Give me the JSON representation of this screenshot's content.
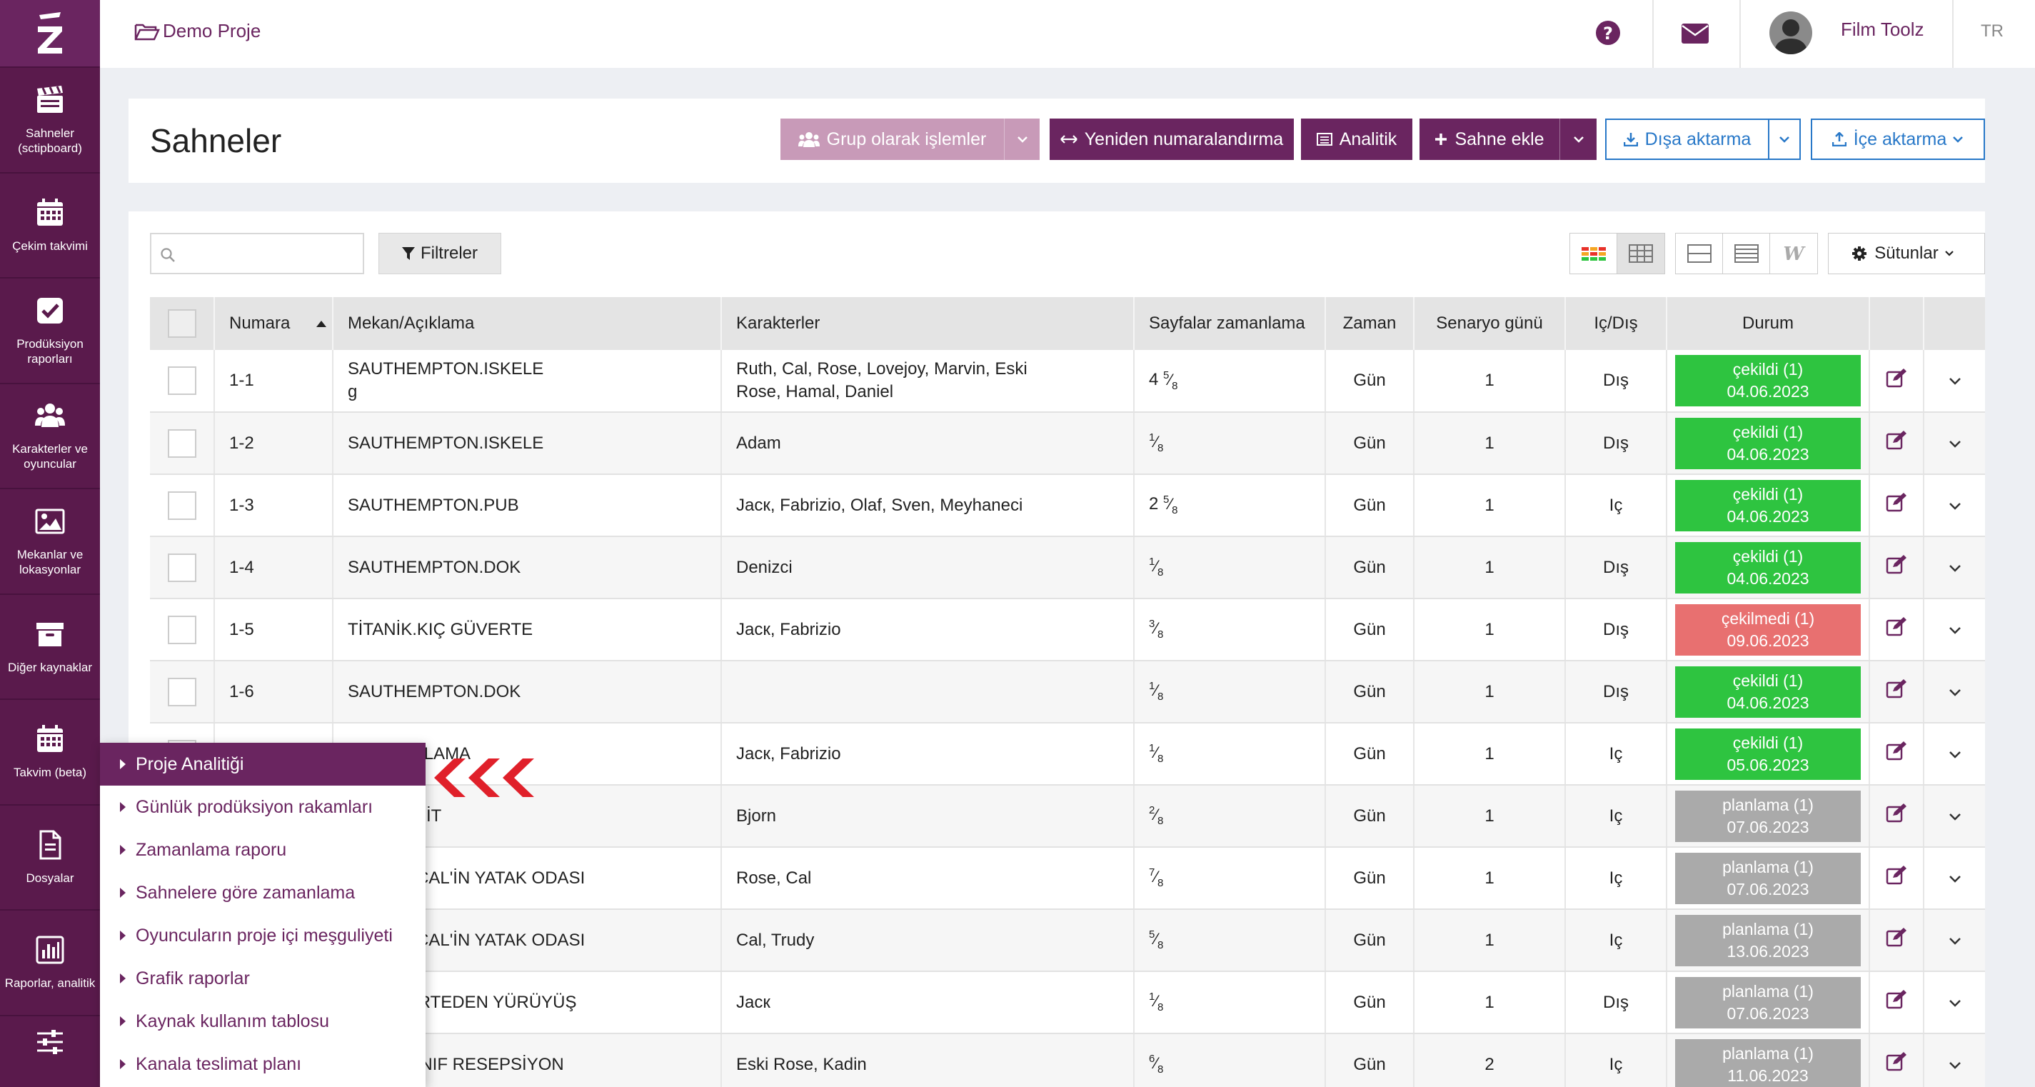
{
  "sidebar": {
    "items": [
      {
        "label": "Sahneler (sctipboard)",
        "icon": "clapperboard-icon"
      },
      {
        "label": "Çekim takvimi",
        "icon": "calendar-icon"
      },
      {
        "label": "Prodüksiyon raporları",
        "icon": "checkbox-icon"
      },
      {
        "label": "Karakterler ve oyuncular",
        "icon": "users-icon"
      },
      {
        "label": "Mekanlar ve lokasyonlar",
        "icon": "image-icon"
      },
      {
        "label": "Diğer kaynaklar",
        "icon": "archive-icon"
      },
      {
        "label": "Takvim (beta)",
        "icon": "calendar-beta-icon"
      },
      {
        "label": "Dosyalar",
        "icon": "file-icon"
      },
      {
        "label": "Raporlar, analitik",
        "icon": "bar-chart-icon"
      },
      {
        "label": "",
        "icon": "sliders-icon"
      }
    ]
  },
  "topbar": {
    "project": "Demo Proje",
    "user": "Film Toolz",
    "lang": "TR"
  },
  "title_panel": {
    "title": "Sahneler",
    "group_ops": "Grup olarak işlemler",
    "renumber": "Yeniden numaralandırma",
    "analytics": "Analitik",
    "add_scene": "Sahne ekle",
    "export": "Dışa aktarma",
    "import": "İçe aktarma"
  },
  "toolbar": {
    "search_placeholder": "",
    "filters": "Filtreler",
    "columns": "Sütunlar"
  },
  "table": {
    "headers": [
      "Numara",
      "Mekan/Açıklama",
      "Karakterler",
      "Sayfalar zamanlama",
      "Zaman",
      "Senaryo günü",
      "Iç/Dış",
      "Durum"
    ],
    "rows": [
      {
        "num": "1-1",
        "loc": "SAUTHEMPTON.ISKELE",
        "loc2": "g",
        "chars": "Ruth, Cal, Rose, Lovejoy, Marvin, Eski",
        "chars2": "Rose, Hamal, Daniel",
        "pw": "4",
        "pn": "5",
        "pd": "8",
        "time": "Gün",
        "day": "1",
        "io": "Dış",
        "status": "çekildi (1)",
        "date": "04.06.2023",
        "color": "#2ec440"
      },
      {
        "num": "1-2",
        "loc": "SAUTHEMPTON.ISKELE",
        "loc2": "",
        "chars": "Adam",
        "chars2": "",
        "pw": "",
        "pn": "1",
        "pd": "8",
        "time": "Gün",
        "day": "1",
        "io": "Dış",
        "status": "çekildi (1)",
        "date": "04.06.2023",
        "color": "#2ec440"
      },
      {
        "num": "1-3",
        "loc": "SAUTHEMPTON.PUB",
        "loc2": "",
        "chars": "Jacк, Fabrizio, Olaf, Sven, Meyhaneci",
        "chars2": "",
        "pw": "2",
        "pn": "5",
        "pd": "8",
        "time": "Gün",
        "day": "1",
        "io": "Iç",
        "status": "çekildi (1)",
        "date": "04.06.2023",
        "color": "#2ec440"
      },
      {
        "num": "1-4",
        "loc": "SAUTHEMPTON.DOK",
        "loc2": "",
        "chars": "Denizci",
        "chars2": "",
        "pw": "",
        "pn": "1",
        "pd": "8",
        "time": "Gün",
        "day": "1",
        "io": "Dış",
        "status": "çekildi (1)",
        "date": "04.06.2023",
        "color": "#2ec440"
      },
      {
        "num": "1-5",
        "loc": "TİTANİK.KIÇ GÜVERTE",
        "loc2": "",
        "chars": "Jacк, Fabrizio",
        "chars2": "",
        "pw": "",
        "pn": "3",
        "pd": "8",
        "time": "Gün",
        "day": "1",
        "io": "Dış",
        "status": "çekilmedi (1)",
        "date": "09.06.2023",
        "color": "#e87070"
      },
      {
        "num": "1-6",
        "loc": "SAUTHEMPTON.DOK",
        "loc2": "",
        "chars": "",
        "chars2": "",
        "pw": "",
        "pn": "1",
        "pd": "8",
        "time": "Gün",
        "day": "1",
        "io": "Dış",
        "status": "çekildi (1)",
        "date": "04.06.2023",
        "color": "#2ec440"
      },
      {
        "num": "",
        "loc": ". SI      AKLAMA",
        "loc2": "",
        "chars": "Jacк, Fabrizio",
        "chars2": "",
        "pw": "",
        "pn": "1",
        "pd": "8",
        "time": "Gün",
        "day": "1",
        "io": "Iç",
        "status": "çekildi (1)",
        "date": "05.06.2023",
        "color": "#2ec440"
      },
      {
        "num": "",
        "loc": "ACK'S SÜİT",
        "loc2": "",
        "chars": "Bjorn",
        "chars2": "",
        "pw": "",
        "pn": "2",
        "pd": "8",
        "time": "Gün",
        "day": "1",
        "io": "Iç",
        "status": "planlama (1)",
        "date": "07.06.2023",
        "color": "#aaaaaa"
      },
      {
        "num": "",
        "loc": "OSE VE CAL'İN YATAK ODASI",
        "loc2": "",
        "chars": "Rose, Cal",
        "chars2": "",
        "pw": "",
        "pn": "7",
        "pd": "8",
        "time": "Gün",
        "day": "1",
        "io": "Iç",
        "status": "planlama (1)",
        "date": "07.06.2023",
        "color": "#aaaaaa"
      },
      {
        "num": "",
        "loc": "OSE VE CAL'İN YATAK ODASI",
        "loc2": "",
        "chars": "Cal, Trudy",
        "chars2": "",
        "pw": "",
        "pn": "5",
        "pd": "8",
        "time": "Gün",
        "day": "1",
        "io": "Iç",
        "status": "planlama (1)",
        "date": "13.06.2023",
        "color": "#aaaaaa"
      },
      {
        "num": "",
        "loc": "İR GÜVERTEDEN YÜRÜYÜŞ",
        "loc2": "",
        "chars": "Jacк",
        "chars2": "",
        "pw": "",
        "pn": "1",
        "pd": "8",
        "time": "Gün",
        "day": "1",
        "io": "Dış",
        "status": "planlama (1)",
        "date": "07.06.2023",
        "color": "#aaaaaa"
      },
      {
        "num": "",
        "loc": "İRİNCİ SINIF RESEPSİYON",
        "loc2": "",
        "chars": "Eski Rose, Kadin",
        "chars2": "",
        "pw": "",
        "pn": "6",
        "pd": "8",
        "time": "Gün",
        "day": "2",
        "io": "Iç",
        "status": "planlama (1)",
        "date": "11.06.2023",
        "color": "#aaaaaa"
      }
    ]
  },
  "dropdown": {
    "items": [
      "Proje Analitiği",
      "Günlük prodüksiyon rakamları",
      "Zamanlama raporu",
      "Sahnelere göre zamanlama",
      "Oyuncuların proje içi meşguliyeti",
      "Grafik raporlar",
      "Kaynak kullanım tablosu",
      "Kanala teslimat planı"
    ]
  },
  "colors": {
    "brand": "#6a2560",
    "sidebar": "#5a1a4c",
    "shot": "#2ec440",
    "not_shot": "#e87070",
    "planning": "#aaaaaa",
    "accent_blue": "#2878c8"
  }
}
